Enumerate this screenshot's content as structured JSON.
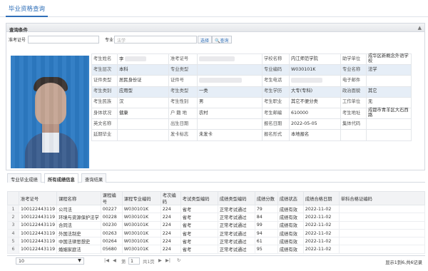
{
  "top_tab": "毕业资格查询",
  "panel_title": "查询条件",
  "search": {
    "exam_no_label": "准考证号",
    "major_label": "专业",
    "major_placeholder": "法学",
    "select_label": "选择",
    "query_label": "查询"
  },
  "info": {
    "name_k": "考生姓名",
    "name_v": "李",
    "examno_k": "准考证号",
    "examno_v": "",
    "school_k": "学校名称",
    "school_v": "内江师范学院",
    "assist_k": "助学单位",
    "assist_v": "成华区新概念外语学校",
    "level_k": "考生层次",
    "level_v": "本科",
    "mtype_k": "专业类型",
    "mtype_v": "",
    "mcode_k": "专业编码",
    "mcode_v": "W030101K",
    "mname_k": "专业名称",
    "mname_v": "法学",
    "idtype_k": "证件类型",
    "idtype_v": "居民身份证",
    "idno_k": "证件号",
    "idno_v": "",
    "phone_k": "考生电话",
    "phone_v": "",
    "email_k": "电子邮件",
    "email_v": "",
    "cat_k": "考生类别",
    "cat_v": "应用型",
    "stype_k": "考生类型",
    "stype_v": "一类",
    "edu_k": "考生学历",
    "edu_v": "大专(专科)",
    "pol_k": "政治面貌",
    "pol_v": "其它",
    "nation_k": "考生民族",
    "nation_v": "汉",
    "sex_k": "考生性别",
    "sex_v": "男",
    "job_k": "考生职业",
    "job_v": "其它不便分类",
    "work_k": "工作单位",
    "work_v": "无",
    "health_k": "身体状况",
    "health_v": "健康",
    "hukou_k": "户 籍 地",
    "hukou_v": "农村",
    "post_k": "考生邮编",
    "post_v": "610000",
    "addr_k": "考生地址",
    "addr_v": "成都市青羊区大石西路",
    "en_k": "英文名称",
    "en_v": "",
    "birth_k": "出生日期",
    "birth_v": "",
    "reg_k": "报名日期",
    "reg_v": "2022-05-05",
    "group_k": "集体代码",
    "group_v": "",
    "delay_k": "延期毕业",
    "delay_v": "",
    "cert_k": "发卡标志",
    "cert_v": "未发卡",
    "form_k": "报名形式",
    "form_v": "本地报名"
  },
  "tabs": [
    "专业毕业成绩",
    "所有成绩信息",
    "查询结果"
  ],
  "grid": {
    "headers": [
      "准考证号",
      "课程名称",
      "课程编号",
      "课程专业编码",
      "考次编码",
      "考试类型编码",
      "成绩类型编码",
      "成绩分数",
      "成绩状态",
      "成绩合格日期",
      "单科合格证编码"
    ],
    "rows": [
      [
        "1",
        "100122443119",
        "公司法",
        "00227",
        "W030101K",
        "224",
        "省考",
        "正常考试通过",
        "79",
        "成绩有效",
        "2022-11-02",
        ""
      ],
      [
        "2",
        "100122443119",
        "环境与资源保护法学",
        "00228",
        "W030101K",
        "224",
        "省考",
        "正常考试通过",
        "84",
        "成绩有效",
        "2022-11-02",
        ""
      ],
      [
        "3",
        "100122443119",
        "合同法",
        "00230",
        "W030101K",
        "224",
        "省考",
        "正常考试通过",
        "99",
        "成绩有效",
        "2022-11-02",
        ""
      ],
      [
        "4",
        "100122443119",
        "外国法制史",
        "00263",
        "W030101K",
        "224",
        "省考",
        "正常考试通过",
        "94",
        "成绩有效",
        "2022-11-02",
        ""
      ],
      [
        "5",
        "100122443119",
        "中国法律思想史",
        "00264",
        "W030101K",
        "224",
        "省考",
        "正常考试通过",
        "61",
        "成绩有效",
        "2022-11-02",
        ""
      ],
      [
        "6",
        "100122443119",
        "婚姻家庭法",
        "05680",
        "W030101K",
        "224",
        "省考",
        "正常考试通过",
        "95",
        "成绩有效",
        "2022-11-02",
        ""
      ]
    ]
  },
  "pager": {
    "page_size": "10",
    "page_label": "第",
    "page_value": "1",
    "total_pages": "共1页",
    "summary": "显示1到6,共6记录"
  }
}
